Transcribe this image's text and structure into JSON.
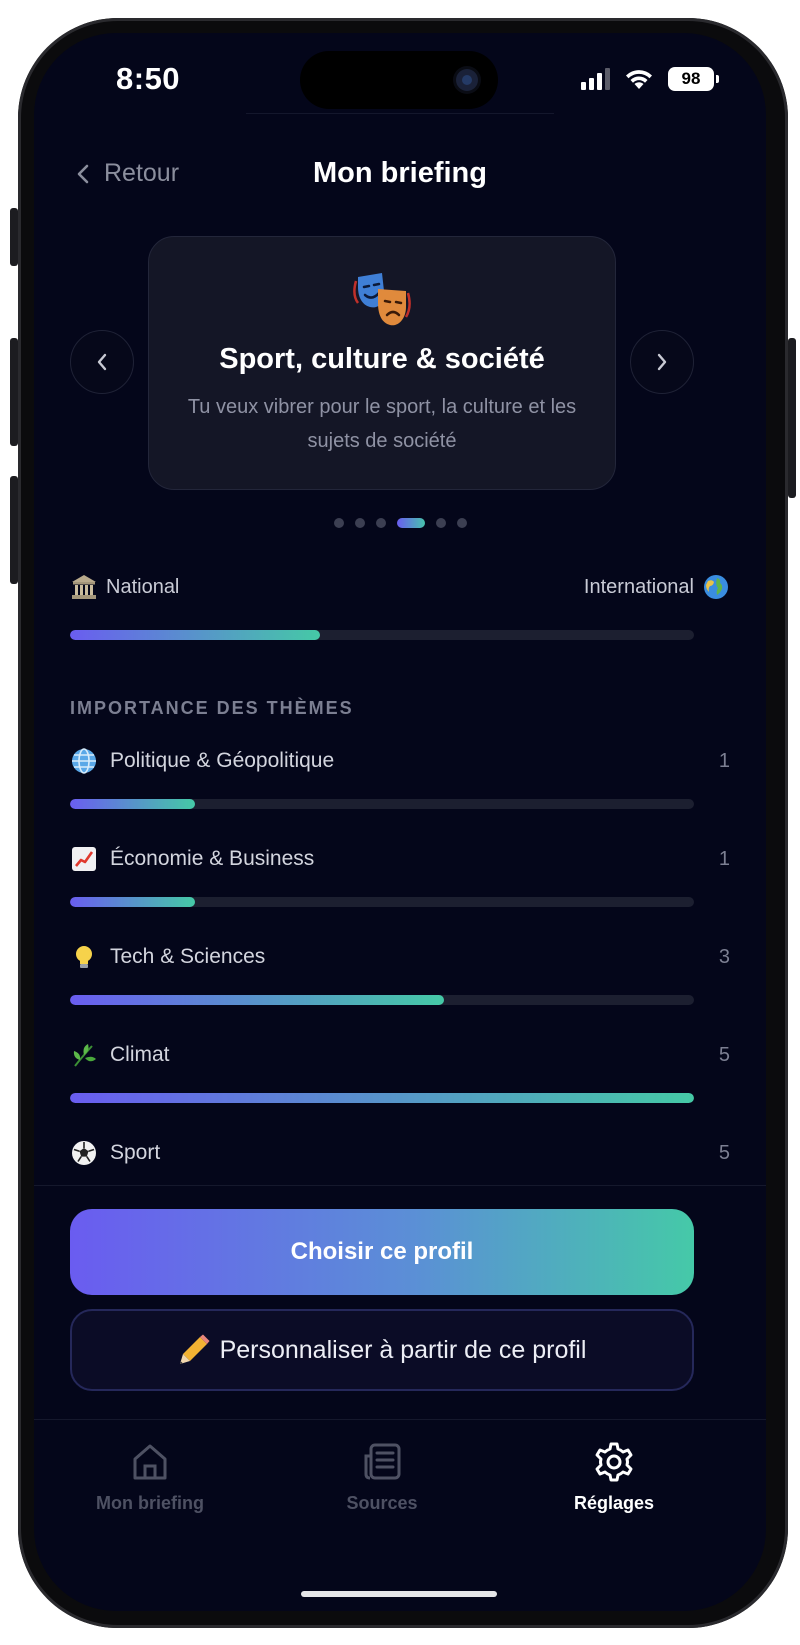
{
  "status_bar": {
    "time": "8:50",
    "battery": "98"
  },
  "header": {
    "back_label": "Retour",
    "title": "Mon briefing"
  },
  "profile_card": {
    "title": "Sport, culture & société",
    "subtitle": "Tu veux vibrer pour le sport, la culture et les sujets de société",
    "icon": "theater-masks-icon",
    "page_count": 6,
    "active_page": 4
  },
  "scope_slider": {
    "left_label": "National",
    "right_label": "International",
    "left_icon": "classical-building-icon",
    "right_icon": "globe-icon",
    "value": 0.4
  },
  "themes": {
    "section_label": "IMPORTANCE DES THÈMES",
    "max": 5,
    "items": [
      {
        "label": "Politique & Géopolitique",
        "value": 1,
        "icon": "globe-meridians-icon"
      },
      {
        "label": "Économie & Business",
        "value": 1,
        "icon": "chart-increasing-icon"
      },
      {
        "label": "Tech & Sciences",
        "value": 3,
        "icon": "light-bulb-icon"
      },
      {
        "label": "Climat",
        "value": 5,
        "icon": "herb-icon"
      },
      {
        "label": "Sport",
        "value": 5,
        "icon": "soccer-ball-icon"
      }
    ]
  },
  "actions": {
    "primary_label": "Choisir ce profil",
    "secondary_label": "Personnaliser à partir de ce profil",
    "secondary_icon": "pencil-icon"
  },
  "tab_bar": {
    "items": [
      {
        "label": "Mon briefing",
        "icon": "home-icon",
        "active": false
      },
      {
        "label": "Sources",
        "icon": "newspaper-icon",
        "active": false
      },
      {
        "label": "Réglages",
        "icon": "gear-icon",
        "active": true
      }
    ]
  },
  "colors": {
    "background": "#04061a",
    "accent_start": "#6a5df0",
    "accent_end": "#45c9a6"
  }
}
